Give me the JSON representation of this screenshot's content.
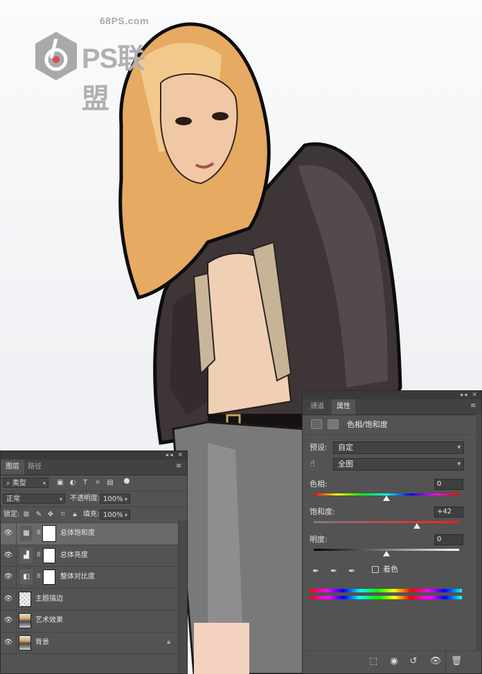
{
  "watermark": {
    "site": "68PS.com",
    "name": "PS联盟"
  },
  "colors": {
    "panel_bg": "#535353",
    "panel_dark": "#424242",
    "selected_layer": "#6a6a6a",
    "canvas_bg": "#f1f1f3"
  },
  "layers_panel": {
    "tabs": [
      "图层",
      "路径"
    ],
    "filter": {
      "kind_label": "类型",
      "icons": [
        "image-filter-icon",
        "adjustment-filter-icon",
        "type-filter-icon",
        "shape-filter-icon",
        "smart-object-filter-icon",
        "filter-toggle"
      ]
    },
    "blend_mode": "正常",
    "opacity_label": "不透明度:",
    "opacity_value": "100%",
    "lock_label": "锁定:",
    "fill_label": "填充:",
    "fill_value": "100%",
    "layers": [
      {
        "name": "总体饱和度",
        "type": "hue-saturation",
        "has_mask": true,
        "selected": true
      },
      {
        "name": "总体亮度",
        "type": "levels",
        "has_mask": true,
        "selected": false
      },
      {
        "name": "整体对比度",
        "type": "gradient",
        "has_mask": true,
        "selected": false
      },
      {
        "name": "主题描边",
        "type": "pixel-transparent",
        "has_mask": false,
        "selected": false
      },
      {
        "name": "艺术效果",
        "type": "pixel-photo",
        "has_mask": false,
        "selected": false
      },
      {
        "name": "背景",
        "type": "background",
        "has_mask": false,
        "selected": false,
        "locked": true
      }
    ]
  },
  "properties_panel": {
    "tabs": [
      "通道",
      "属性"
    ],
    "active_tab": "属性",
    "title": "色相/饱和度",
    "preset_label": "预设:",
    "preset_value": "自定",
    "channel_value": "全图",
    "hue": {
      "label": "色相:",
      "value": "0",
      "position": 0.5
    },
    "saturation": {
      "label": "饱和度:",
      "value": "+42",
      "position": 0.71
    },
    "lightness": {
      "label": "明度:",
      "value": "0",
      "position": 0.5
    },
    "colorize_label": "着色",
    "colorize_checked": false,
    "footer_icons": [
      "clip-to-layer-icon",
      "view-previous-icon",
      "reset-icon",
      "visibility-icon",
      "trash-icon"
    ]
  }
}
